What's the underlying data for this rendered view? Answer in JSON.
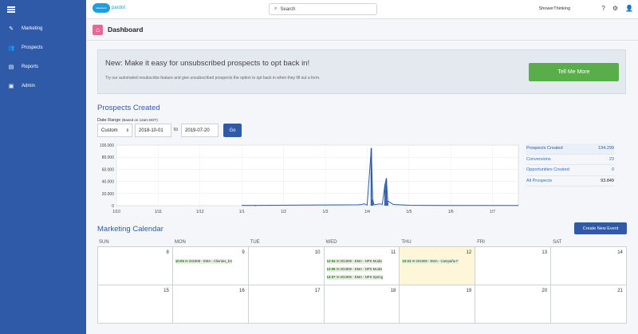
{
  "sidebar": {
    "items": [
      {
        "label": "Marketing",
        "icon": "pencil-icon"
      },
      {
        "label": "Prospects",
        "icon": "people-icon"
      },
      {
        "label": "Reports",
        "icon": "chart-icon"
      },
      {
        "label": "Admin",
        "icon": "briefcase-icon"
      }
    ]
  },
  "topbar": {
    "logo_cloud": "salesforce",
    "logo_text": "pardot",
    "search_placeholder": "Search",
    "account": "ShowerThinking"
  },
  "page": {
    "title": "Dashboard"
  },
  "banner": {
    "title": "New: Make it easy for unsubscribed prospects to opt back in!",
    "text": "Try our automated resubscribe feature and give unsubscribed prospects the option to opt back in when they fill out a form.",
    "button": "Tell Me More"
  },
  "prospects": {
    "title": "Prospects Created",
    "date_range_label": "Date Range",
    "date_range_note": "(Based on 12am EDT):",
    "range_option": "Custom",
    "from": "2018-10-01",
    "to_label": "to",
    "to": "2019-07-20",
    "go": "Go"
  },
  "stats": [
    {
      "label": "Prospects Created",
      "value": "194.299"
    },
    {
      "label": "Conversions",
      "value": "23"
    },
    {
      "label": "Opportunities Created",
      "value": "0"
    },
    {
      "label": "All Prospects",
      "value": "93.849"
    }
  ],
  "chart_data": {
    "type": "line",
    "title": "",
    "xlabel": "",
    "ylabel": "",
    "ylim": [
      0,
      100000
    ],
    "yticks": [
      "0",
      "20.000",
      "40.000",
      "60.000",
      "80.000",
      "100.000"
    ],
    "xticks": [
      "1/10",
      "1/11",
      "1/12",
      "1/1",
      "1/2",
      "1/3",
      "1/4",
      "1/5",
      "1/6",
      "1/7"
    ],
    "x": [
      "1/10",
      "1/11",
      "1/12",
      "1/1",
      "1/2",
      "1/3",
      "3/25",
      "3/28",
      "3/29",
      "3/30",
      "4/1",
      "4/4",
      "4/5",
      "4/6",
      "4/10",
      "4/12",
      "4/14",
      "4/15",
      "4/16",
      "4/20",
      "5/1",
      "6/1",
      "7/1",
      "7/20"
    ],
    "values": [
      0,
      0,
      300,
      500,
      300,
      400,
      1500,
      2000,
      3000,
      2500,
      1000,
      95000,
      10000,
      1500,
      3000,
      2000,
      35000,
      45000,
      8000,
      2000,
      600,
      400,
      300,
      300
    ],
    "grid": true
  },
  "calendar": {
    "title": "Marketing Calendar",
    "new_event": "Create New Event",
    "days": [
      "SUN",
      "MON",
      "TUE",
      "WED",
      "THU",
      "FRI",
      "SAT"
    ],
    "week1": [
      {
        "num": "8",
        "events": []
      },
      {
        "num": "9",
        "events": [
          {
            "time": "10:05",
            "text": "201908 - EMA - Clientes_En"
          }
        ]
      },
      {
        "num": "10",
        "events": []
      },
      {
        "num": "11",
        "events": [
          {
            "time": "12:04",
            "text": "201909 - EMA - NPS Modis"
          },
          {
            "time": "12:06",
            "text": "201909 - EMA - NPS Modis"
          },
          {
            "time": "12:07",
            "text": "201909 - EMA - NPS Spring"
          }
        ]
      },
      {
        "num": "12",
        "events": [
          {
            "time": "10:23",
            "text": "201909 - EMA - Campaña F"
          }
        ]
      },
      {
        "num": "13",
        "events": []
      },
      {
        "num": "14",
        "events": []
      }
    ],
    "week2": [
      {
        "num": "15"
      },
      {
        "num": "16"
      },
      {
        "num": "17"
      },
      {
        "num": "18"
      },
      {
        "num": "19"
      },
      {
        "num": "20"
      },
      {
        "num": "21"
      }
    ]
  }
}
